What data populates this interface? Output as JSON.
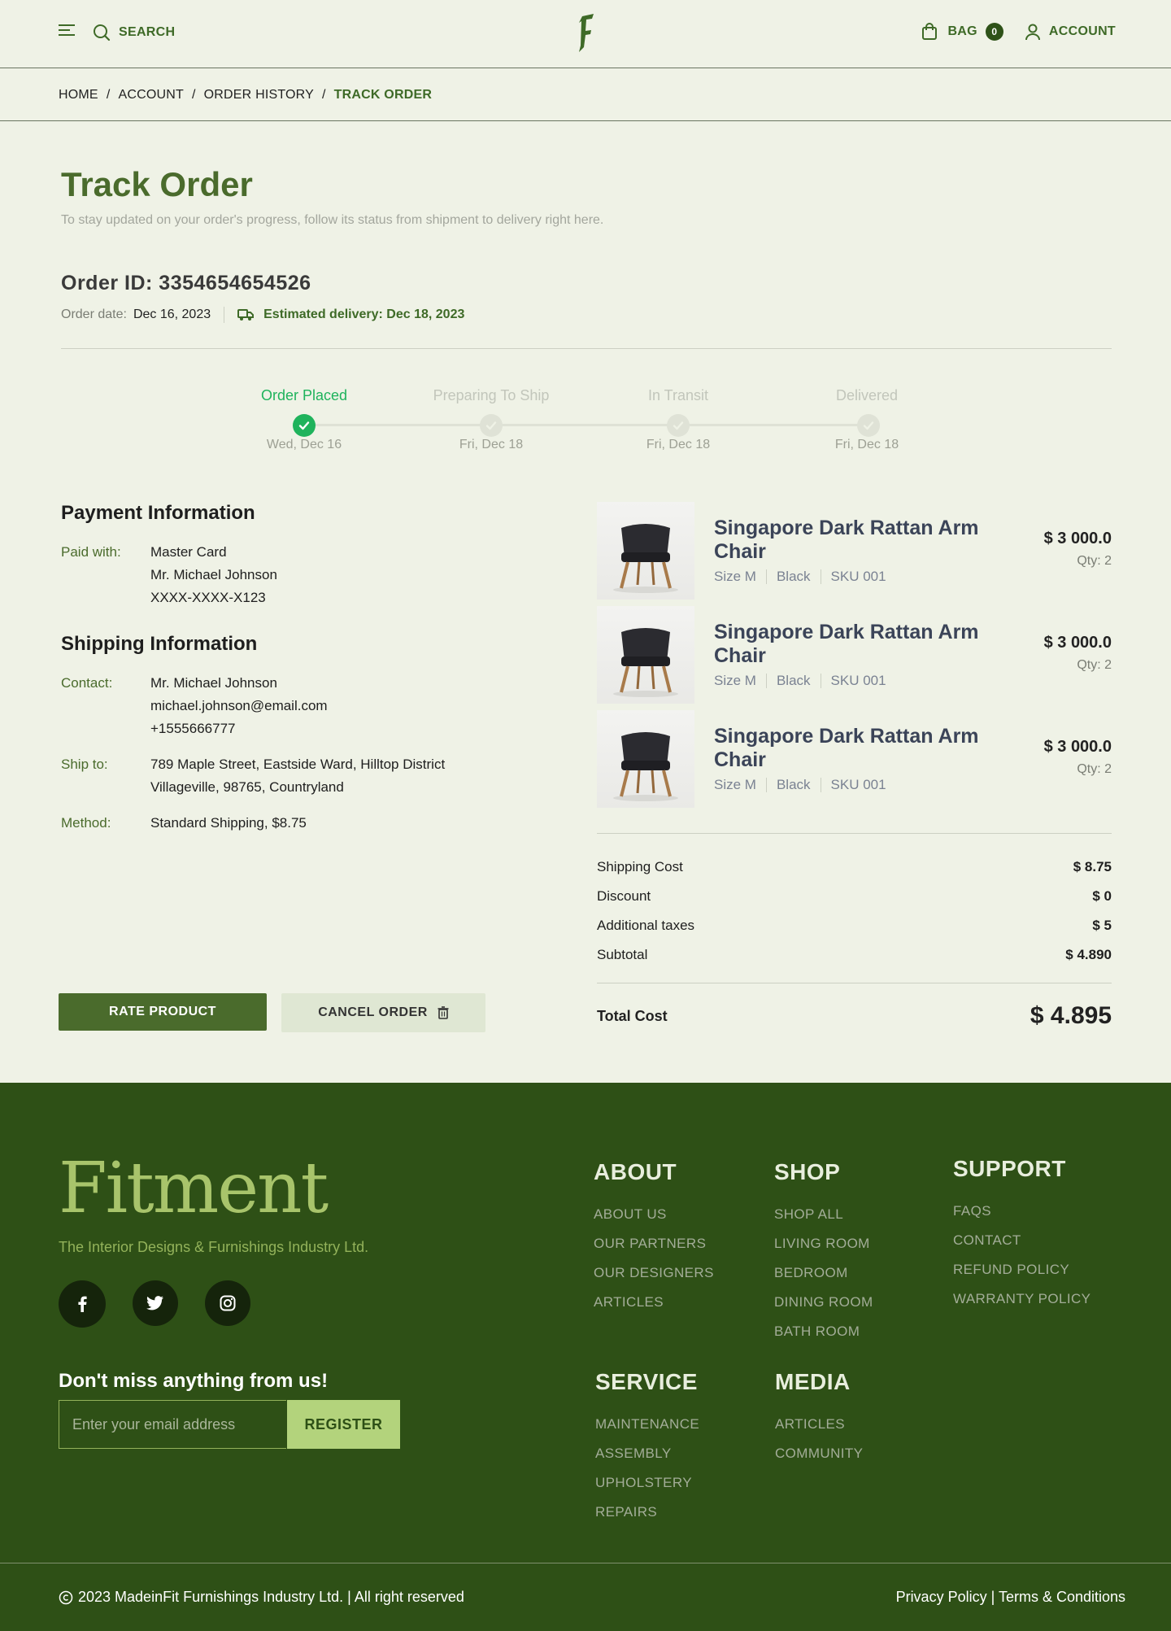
{
  "header": {
    "search_label": "SEARCH",
    "bag_label": "BAG",
    "bag_count": "0",
    "account_label": "ACCOUNT"
  },
  "breadcrumb": [
    "HOME",
    "ACCOUNT",
    "ORDER HISTORY",
    "TRACK ORDER"
  ],
  "page": {
    "title": "Track Order",
    "subtitle": "To stay updated on your order's progress, follow its status from shipment to delivery right here."
  },
  "order": {
    "id_label": "Order ID: 3354654654526",
    "date_label": "Order date:",
    "date": "Dec 16, 2023",
    "estimated": "Estimated delivery: Dec 18, 2023"
  },
  "progress": [
    {
      "title": "Order Placed",
      "date": "Wed, Dec 16",
      "done": true
    },
    {
      "title": "Preparing To Ship",
      "date": "Fri, Dec 18",
      "done": false
    },
    {
      "title": "In Transit",
      "date": "Fri, Dec 18",
      "done": false
    },
    {
      "title": "Delivered",
      "date": "Fri, Dec 18",
      "done": false
    }
  ],
  "payment": {
    "title": "Payment Information",
    "paid_with_label": "Paid with:",
    "lines": [
      "Master Card",
      "Mr. Michael Johnson",
      "XXXX-XXXX-X123"
    ]
  },
  "shipping": {
    "title": "Shipping Information",
    "contact_label": "Contact:",
    "contact_lines": [
      "Mr. Michael Johnson",
      "michael.johnson@email.com",
      "+1555666777"
    ],
    "ship_to_label": "Ship to:",
    "ship_to_lines": [
      "789 Maple Street, Eastside Ward, Hilltop District",
      "Villageville, 98765, Countryland"
    ],
    "method_label": "Method:",
    "method": "Standard Shipping, $8.75"
  },
  "items": [
    {
      "name": "Singapore Dark Rattan Arm Chair",
      "size": "Size M",
      "color": "Black",
      "sku": "SKU 001",
      "price": "$ 3 000.0",
      "qty": "Qty: 2"
    },
    {
      "name": "Singapore Dark Rattan Arm Chair",
      "size": "Size M",
      "color": "Black",
      "sku": "SKU 001",
      "price": "$ 3 000.0",
      "qty": "Qty: 2"
    },
    {
      "name": "Singapore Dark Rattan Arm Chair",
      "size": "Size M",
      "color": "Black",
      "sku": "SKU 001",
      "price": "$ 3 000.0",
      "qty": "Qty: 2"
    }
  ],
  "costs": [
    {
      "label": "Shipping Cost",
      "value": "$ 8.75"
    },
    {
      "label": "Discount",
      "value": "$ 0"
    },
    {
      "label": "Additional taxes",
      "value": "$ 5"
    },
    {
      "label": "Subtotal",
      "value": "$ 4.890"
    }
  ],
  "total": {
    "label": "Total Cost",
    "value": "$ 4.895"
  },
  "buttons": {
    "rate": "RATE PRODUCT",
    "cancel": "CANCEL ORDER"
  },
  "footer": {
    "logo": "Fitment",
    "tagline": "The Interior Designs & Furnishings Industry Ltd.",
    "newsletter_title": "Don't miss anything from us!",
    "email_placeholder": "Enter your email address",
    "register": "REGISTER",
    "columns": {
      "about": {
        "title": "ABOUT",
        "links": [
          "ABOUT US",
          "OUR PARTNERS",
          "OUR DESIGNERS",
          "ARTICLES"
        ]
      },
      "shop": {
        "title": "SHOP",
        "links": [
          "SHOP ALL",
          "LIVING ROOM",
          "BEDROOM",
          "DINING ROOM",
          "BATH ROOM"
        ]
      },
      "support": {
        "title": "SUPPORT",
        "links": [
          "FAQS",
          "CONTACT",
          "REFUND POLICY",
          "WARRANTY POLICY"
        ]
      },
      "service": {
        "title": "SERVICE",
        "links": [
          "MAINTENANCE",
          "ASSEMBLY",
          "UPHOLSTERY",
          "REPAIRS"
        ]
      },
      "media": {
        "title": "MEDIA",
        "links": [
          "ARTICLES",
          "COMMUNITY"
        ]
      }
    },
    "copyright": "2023 MadeinFit Furnishings Industry Ltd.  | All right reserved",
    "legal": "Privacy Policy | Terms & Conditions"
  },
  "colors": {
    "brand": "#4a6b2c",
    "success": "#1fb35c",
    "footer_bg": "#2e5016",
    "accent": "#b3d37c"
  }
}
